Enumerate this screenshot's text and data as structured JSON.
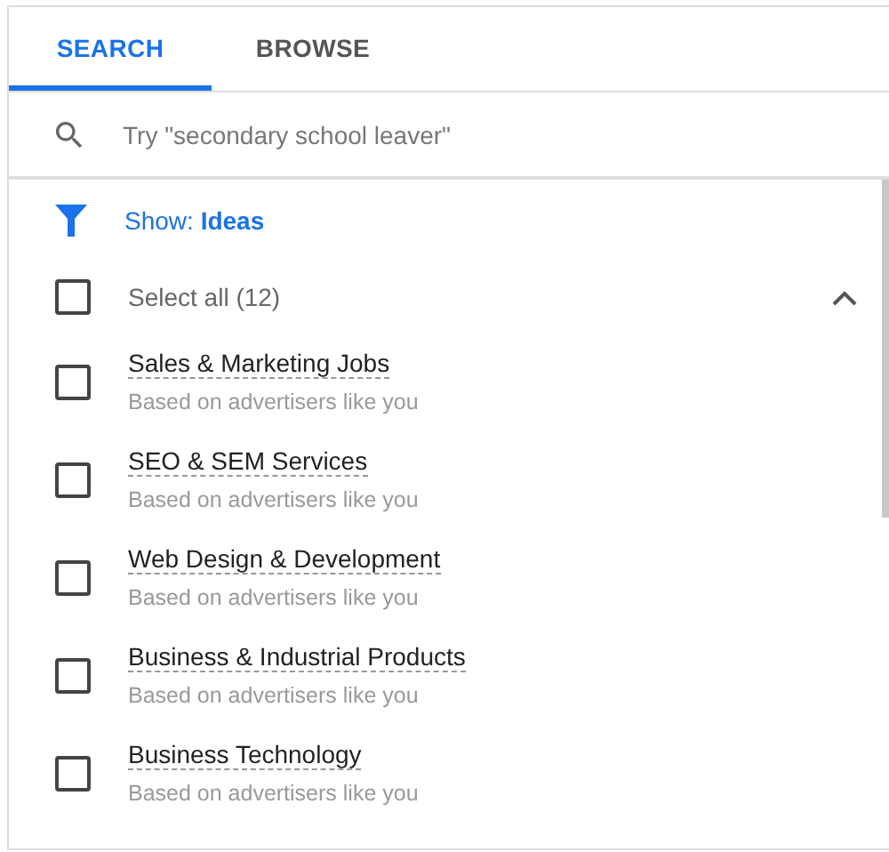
{
  "tabs": [
    {
      "label": "SEARCH",
      "selected": true
    },
    {
      "label": "BROWSE",
      "selected": false
    }
  ],
  "search": {
    "placeholder": "Try \"secondary school leaver\""
  },
  "filter": {
    "label": "Show: **Ideas**"
  },
  "select_all": {
    "label": "Select all (12)",
    "checked": false,
    "expanded": true
  },
  "items": [
    {
      "title": "Sales & Marketing Jobs",
      "subtitle": "Based on advertisers like you",
      "checked": false
    },
    {
      "title": "SEO & SEM Services",
      "subtitle": "Based on advertisers like you",
      "checked": false
    },
    {
      "title": "Web Design & Development",
      "subtitle": "Based on advertisers like you",
      "checked": false
    },
    {
      "title": "Business & Industrial Products",
      "subtitle": "Based on advertisers like you",
      "checked": false
    },
    {
      "title": "Business Technology",
      "subtitle": "Based on advertisers like you",
      "checked": false
    }
  ]
}
